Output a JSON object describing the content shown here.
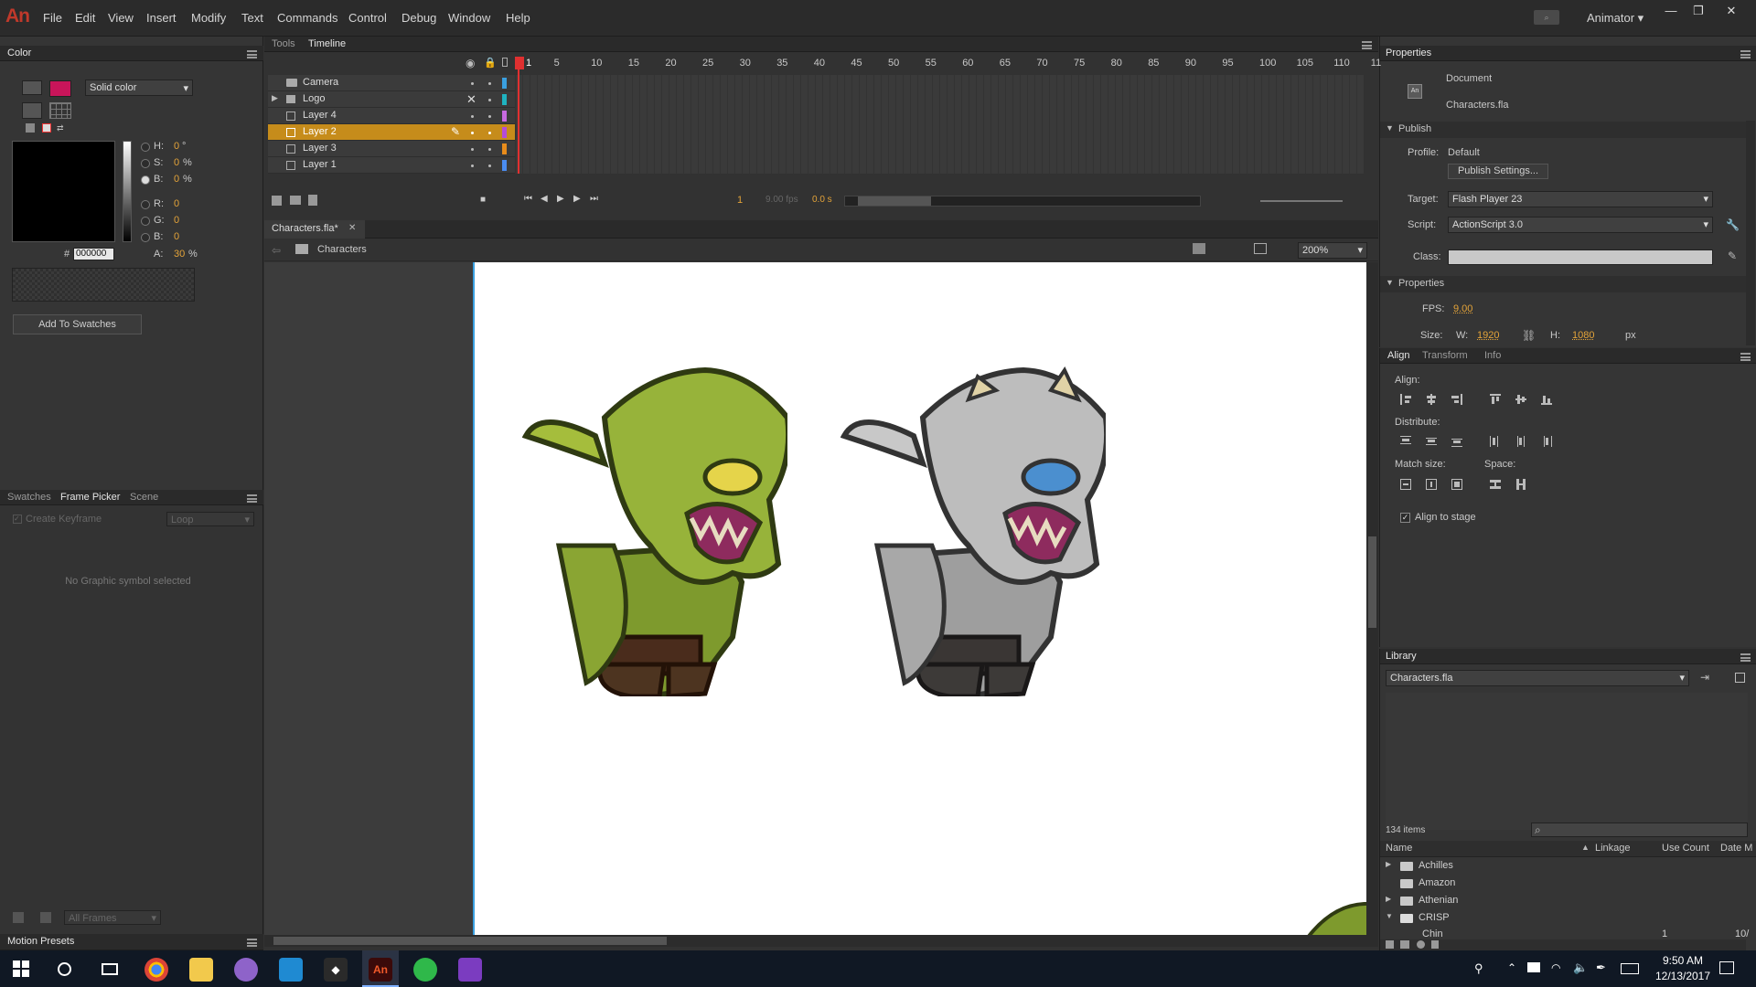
{
  "app": {
    "logo": "An",
    "workspace": "Animator"
  },
  "menu": [
    "File",
    "Edit",
    "View",
    "Insert",
    "Modify",
    "Text",
    "Commands",
    "Control",
    "Debug",
    "Window",
    "Help"
  ],
  "color_panel": {
    "tab": "Color",
    "fill_type": "Solid color",
    "fill_color": "#c8155a",
    "hsb": {
      "h_label": "H:",
      "h": "0",
      "h_unit": "°",
      "s_label": "S:",
      "s": "0",
      "s_unit": "%",
      "b_label": "B:",
      "b": "0",
      "b_unit": "%"
    },
    "rgb": {
      "r_label": "R:",
      "r": "0",
      "g_label": "G:",
      "g": "0",
      "b_label": "B:",
      "b": "0"
    },
    "hex_label": "#",
    "hex": "000000",
    "alpha_label": "A:",
    "alpha": "30",
    "alpha_unit": "%",
    "add_swatches": "Add To Swatches"
  },
  "lower_left": {
    "tabs": [
      "Swatches",
      "Frame Picker",
      "Scene"
    ],
    "create_keyframe": "Create Keyframe",
    "loop": "Loop",
    "empty_msg": "No Graphic symbol selected",
    "all_frames": "All Frames",
    "motion_presets": "Motion Presets"
  },
  "timeline": {
    "tabs": [
      "Tools",
      "Timeline"
    ],
    "ticks": [
      "1",
      "5",
      "10",
      "15",
      "20",
      "25",
      "30",
      "35",
      "40",
      "45",
      "50",
      "55",
      "60",
      "65",
      "70",
      "75",
      "80",
      "85",
      "90",
      "95",
      "100",
      "105",
      "110",
      "11"
    ],
    "layers": [
      {
        "name": "Camera",
        "color": "#3aa0e0"
      },
      {
        "name": "Logo",
        "color": "#1fb3c0"
      },
      {
        "name": "Layer 4",
        "color": "#c86ae0"
      },
      {
        "name": "Layer 2",
        "color": "#b44cd8"
      },
      {
        "name": "Layer 3",
        "color": "#e88c1b"
      },
      {
        "name": "Layer 1",
        "color": "#4a8cf0"
      }
    ],
    "current_frame": "1",
    "fps": "9.00 fps",
    "time": "0.0 s"
  },
  "document": {
    "tab": "Characters.fla*",
    "scene": "Characters",
    "zoom": "200%"
  },
  "properties": {
    "tab": "Properties",
    "doc_type": "Document",
    "doc_name": "Characters.fla",
    "publish_header": "Publish",
    "profile_label": "Profile:",
    "profile": "Default",
    "publish_settings": "Publish Settings...",
    "target_label": "Target:",
    "target": "Flash Player 23",
    "script_label": "Script:",
    "script": "ActionScript 3.0",
    "class_label": "Class:",
    "props_header": "Properties",
    "fps_label": "FPS:",
    "fps": "9.00",
    "size_label": "Size:",
    "w_label": "W:",
    "w": "1920",
    "h_label": "H:",
    "h": "1080",
    "unit": "px"
  },
  "align": {
    "tabs": [
      "Align",
      "Transform",
      "Info"
    ],
    "align_label": "Align:",
    "distribute_label": "Distribute:",
    "match_label": "Match size:",
    "space_label": "Space:",
    "stage_label": "Align to stage"
  },
  "library": {
    "tab": "Library",
    "file": "Characters.fla",
    "count": "134 items",
    "columns": [
      "Name",
      "Linkage",
      "Use Count",
      "Date M"
    ],
    "items": [
      {
        "name": "Achilles",
        "expand": "▶"
      },
      {
        "name": "Amazon",
        "expand": ""
      },
      {
        "name": "Athenian",
        "expand": "▶"
      },
      {
        "name": "CRISP",
        "expand": "▼"
      },
      {
        "name": "Chin",
        "expand": "",
        "use": "1",
        "date": "10/"
      }
    ]
  },
  "taskbar": {
    "time": "9:50 AM",
    "date": "12/13/2017"
  }
}
